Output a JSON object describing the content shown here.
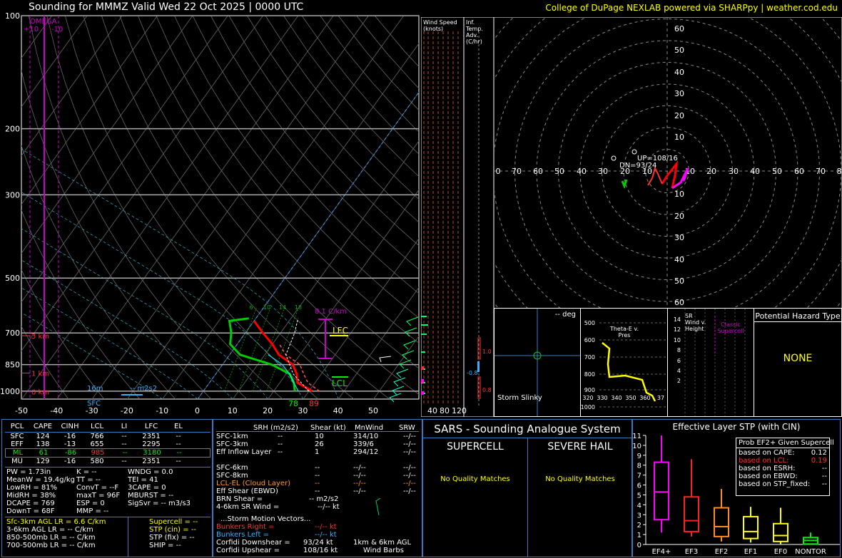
{
  "header": {
    "title": "Sounding for MMMZ Valid  Wed 22 Oct 2025 | 0000 UTC",
    "credit": "College of DuPage NEXLAB powered via SHARPpy | weather.cod.edu"
  },
  "skewt": {
    "omega_label": "OMEGA",
    "omega_plus": "+10",
    "omega_minus": "-10",
    "pressure_ticks": [
      "100",
      "200",
      "300",
      "500",
      "700",
      "850",
      "1000"
    ],
    "temp_ticks": [
      "-50",
      "-40",
      "-30",
      "-20",
      "-10",
      "0",
      "10",
      "20",
      "30",
      "40",
      "50"
    ],
    "height_labels": [
      "3 km",
      "1 km",
      "0 km"
    ],
    "mixing_ratio_labels": [
      "6",
      "10",
      "14",
      "18"
    ],
    "lapse_label": "8.1 C/km",
    "lfc_label": "LFC",
    "lcl_label": "LCL",
    "sfc_label": "SFC",
    "srh_height": "16m",
    "srh_value": "-- m2s2",
    "sfc_td": "78",
    "sfc_t": "89"
  },
  "wind_speed": {
    "title": "Wind Speed (knots)",
    "ticks": [
      "40",
      "80",
      "120"
    ]
  },
  "inf_temp": {
    "title": "Inf. Temp. Adv. (C/hr)",
    "values": [
      "1.0",
      "-0.8",
      "0.8"
    ]
  },
  "hodograph": {
    "ticks_x": [
      "0",
      "70",
      "60",
      "50",
      "40",
      "30",
      "20",
      "10",
      "10",
      "20",
      "30",
      "40",
      "50",
      "60",
      "70",
      "8"
    ],
    "ticks_y": [
      "60",
      "50",
      "40",
      "30",
      "20",
      "10",
      "10",
      "20",
      "30",
      "40",
      "50",
      "60"
    ],
    "up_label": "UP=108/16",
    "dn_label": "DN=93/24"
  },
  "slinky": {
    "deg": "-- deg",
    "label": "Storm Slinky"
  },
  "theta": {
    "title": "Theta-E v. Pres",
    "y_ticks": [
      "500",
      "600",
      "700",
      "800",
      "900",
      "1000"
    ],
    "x_ticks": [
      "320",
      "330",
      "340",
      "350",
      "360",
      "37"
    ]
  },
  "srwind": {
    "title": "SR Wind v. Height",
    "classic": "Classic Supercell",
    "y_ticks": [
      "14",
      "12",
      "10",
      "8",
      "6",
      "4",
      "2"
    ]
  },
  "hazard": {
    "title": "Potential Hazard Type",
    "value": "NONE"
  },
  "parcel_table": {
    "headers": [
      "PCL",
      "CAPE",
      "CINH",
      "LCL",
      "LI",
      "LFC",
      "EL"
    ],
    "rows": [
      [
        "SFC",
        "124",
        "-16",
        "766",
        "--",
        "2351",
        "--"
      ],
      [
        "EFF",
        "138",
        "-13",
        "655",
        "--",
        "2295",
        "--"
      ],
      [
        "ML",
        "61",
        "-86",
        "985",
        "--",
        "3180",
        "--"
      ],
      [
        "MU",
        "129",
        "-16",
        "580",
        "--",
        "2351",
        "--"
      ]
    ]
  },
  "indices": {
    "col1": [
      "PW = 1.73in",
      "MeanW = 19.4g/kg",
      "LowRH = 81%",
      "MidRH = 38%",
      "DCAPE = 769",
      "DownT = 68F"
    ],
    "col2": [
      "K = --",
      "TT = --",
      "ConvT = --F",
      "maxT = 96F",
      "ESP = 0",
      "MMP = --"
    ],
    "col3": [
      "WNDG = 0.0",
      "TEI = 41",
      "3CAPE = 0",
      "MBURST = --",
      "",
      "SigSvr = -- m3/s3"
    ]
  },
  "lapse_rates": [
    "Sfc-3km AGL LR = 6.6 C/km",
    "3-6km AGL LR = -- C/km",
    "850-500mb LR = -- C/km",
    "700-500mb LR = -- C/km"
  ],
  "params": [
    "Supercell = --",
    "STP (cin) = --",
    "STP (fix) = --",
    "SHIP = --"
  ],
  "kinematics": {
    "headers": [
      "SRH (m2/s2)",
      "Shear (kt)",
      "MnWind",
      "SRW"
    ],
    "rows": [
      [
        "SFC-1km",
        "--",
        "10",
        "314/10",
        "--/--"
      ],
      [
        "SFC-3km",
        "--",
        "26",
        "339/6",
        "--/--"
      ],
      [
        "Eff Inflow Layer",
        "--",
        "1",
        "294/12",
        "--/--"
      ],
      [
        "",
        "",
        "",
        "",
        ""
      ],
      [
        "SFC-6km",
        "",
        "--",
        "--/--",
        "--/--"
      ],
      [
        "SFC-8km",
        "",
        "--",
        "--/--",
        "--/--"
      ],
      [
        "LCL-EL (Cloud Layer)",
        "",
        "--",
        "--/--",
        "--/--"
      ],
      [
        "Eff Shear (EBWD)",
        "",
        "--",
        "--/--",
        "--/--"
      ]
    ],
    "brn_shear": "BRN Shear =",
    "brn_value": "-- m2/s2",
    "sr_wind": "4-6km SR Wind =",
    "sr_value": "--/-- kt",
    "storm_motion": "...Storm Motion Vectors...",
    "bunkers_right": "Bunkers Right =",
    "bunkers_right_value": "--/-- kt",
    "bunkers_left": "Bunkers Left =",
    "bunkers_left_value": "--/-- kt",
    "corfidi_down": "Corfidi Downshear =",
    "corfidi_down_value": "93/24 kt",
    "corfidi_up": "Corfidi Upshear =",
    "corfidi_up_value": "108/16 kt",
    "barbs_label1": "1km & 6km AGL",
    "barbs_label2": "Wind Barbs"
  },
  "sars": {
    "title": "SARS - Sounding Analogue System",
    "supercell": "SUPERCELL",
    "hail": "SEVERE HAIL",
    "supercell_msg": "No Quality Matches",
    "hail_msg": "No Quality Matches"
  },
  "stp": {
    "title": "Effective Layer STP (with CIN)",
    "box_title": "Prob EF2+ Given Supercell",
    "rows": [
      [
        "based on CAPE:",
        "0.12"
      ],
      [
        "based on LCL:",
        "0.19"
      ],
      [
        "based on ESRH:",
        "--"
      ],
      [
        "based on EBWD:",
        "--"
      ],
      [
        "based on STP_fixed:",
        "--"
      ]
    ],
    "y_ticks": [
      "11",
      "10",
      "9",
      "8",
      "7",
      "6",
      "5",
      "4",
      "3",
      "2",
      "1",
      "0"
    ],
    "categories": [
      "EF4+",
      "EF3",
      "EF2",
      "EF1",
      "EF0",
      "NONTOR"
    ]
  },
  "chart_data": [
    {
      "type": "line",
      "title": "Sounding for MMMZ Valid  Wed 22 Oct 2025 | 0000 UTC",
      "xlabel": "",
      "ylabel": "",
      "xlim": [
        -50,
        50
      ],
      "ylim": [
        1050,
        100
      ],
      "y_scale": "log",
      "series": [
        {
          "name": "Temperature",
          "points": [
            [
              31,
              1000
            ],
            [
              25,
              950
            ],
            [
              23,
              900
            ],
            [
              20,
              850
            ],
            [
              14,
              800
            ],
            [
              10,
              750
            ],
            [
              5,
              700
            ],
            [
              0,
              650
            ]
          ]
        },
        {
          "name": "Dewpoint",
          "points": [
            [
              26,
              1000
            ],
            [
              24,
              950
            ],
            [
              21,
              900
            ],
            [
              14,
              850
            ],
            [
              3,
              800
            ],
            [
              -2,
              750
            ],
            [
              -4,
              700
            ],
            [
              -7,
              650
            ],
            [
              -2,
              640
            ]
          ]
        },
        {
          "name": "Virtual Temperature",
          "points": [
            [
              33,
              1000
            ],
            [
              28,
              950
            ],
            [
              25,
              900
            ],
            [
              22,
              850
            ],
            [
              16,
              800
            ],
            [
              12,
              750
            ]
          ]
        },
        {
          "name": "Wetbulb",
          "points": [
            [
              27,
              1000
            ],
            [
              24,
              950
            ],
            [
              21,
              900
            ],
            [
              17,
              850
            ],
            [
              11,
              800
            ]
          ]
        }
      ]
    },
    {
      "type": "bar",
      "title": "Effective Layer STP (with CIN)",
      "categories": [
        "EF4+",
        "EF3",
        "EF2",
        "EF1",
        "EF0",
        "NONTOR"
      ],
      "whisker_low": [
        1.2,
        0.8,
        0.3,
        0.2,
        0.05,
        0.0
      ],
      "q1": [
        2.5,
        1.3,
        0.8,
        0.6,
        0.3,
        0.05
      ],
      "median": [
        5.3,
        2.4,
        1.8,
        1.3,
        0.9,
        0.4
      ],
      "q3": [
        8.3,
        4.8,
        3.7,
        2.8,
        2.1,
        0.7
      ],
      "whisker_high": [
        11.0,
        8.6,
        5.6,
        3.8,
        3.7,
        1.2
      ],
      "ylim": [
        0,
        11
      ]
    }
  ],
  "colors": {
    "temperature": "#ff0000",
    "dewpoint": "#00cc00",
    "virtual": "#ff0000",
    "wetbulb": "#00ffff",
    "omega": "#cc00cc",
    "border": "#3a78c0"
  }
}
